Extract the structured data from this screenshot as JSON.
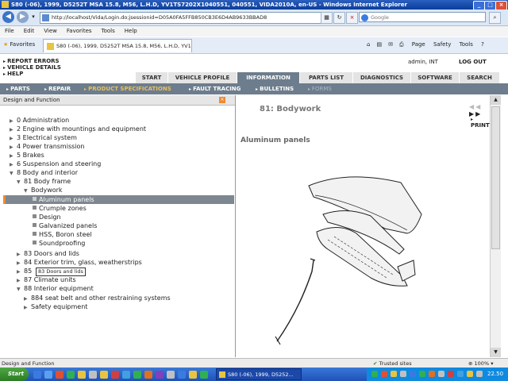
{
  "browser": {
    "title": "S80 (-06), 1999, D5252T MSA 15.8, M56, L.H.D, YV1TS7202X1040551, 040551, VIDA2010A, en-US - Windows Internet Explorer",
    "address": "http://localhost/Vida/Login.do;jsessionid=D05A0FA5FFB850CB3E6D4AB9633BBAD8",
    "search_placeholder": "Google",
    "menu": [
      "File",
      "Edit",
      "View",
      "Favorites",
      "Tools",
      "Help"
    ],
    "favorites_label": "Favorites",
    "tab_title": "S80 (-06), 1999, D5252T MSA 15.8, M56, L.H.D, YV1...",
    "toolbar_items": [
      "Page",
      "Safety",
      "Tools"
    ]
  },
  "app": {
    "top_links": [
      "REPORT ERRORS",
      "VEHICLE DETAILS",
      "HELP"
    ],
    "user": "admin, INT",
    "logout": "LOG OUT",
    "main_tabs": [
      "START",
      "VEHICLE PROFILE",
      "INFORMATION",
      "PARTS LIST",
      "DIAGNOSTICS",
      "SOFTWARE",
      "SEARCH"
    ],
    "active_tab": "INFORMATION",
    "sub_nav": [
      "PARTS",
      "REPAIR",
      "PRODUCT SPECIFICATIONS",
      "FAULT TRACING",
      "BULLETINS",
      "FORMS"
    ],
    "active_sub_nav": "PRODUCT SPECIFICATIONS"
  },
  "left_panel": {
    "title": "Design and Function",
    "tree": [
      "0 Administration",
      "2 Engine with mountings and equipment",
      "3 Electrical system",
      "4 Power transmission",
      "5 Brakes",
      "6 Suspension and steering",
      "8 Body and interior",
      "81 Body frame",
      "Bodywork",
      "Aluminum panels",
      "Crumple zones",
      "Design",
      "Galvanized panels",
      "HSS, Boron steel",
      "Soundproofing",
      "83 Doors and lids",
      "84 Exterior trim, glass, weatherstrips",
      "85",
      "87 Climate units",
      "88 Interior equipment",
      "884 seat belt and other restraining systems",
      "Safety equipment"
    ],
    "selected": "Aluminum panels",
    "tooltip": "83 Doors and lids"
  },
  "document": {
    "title": "81: Bodywork",
    "print": "PRINT",
    "subtitle": "Aluminum panels"
  },
  "status_bar": {
    "text": "Design and Function",
    "trusted": "Trusted sites",
    "zoom": "100%"
  },
  "taskbar": {
    "start": "Start",
    "window": "S80 (-06), 1999, D5252...",
    "time": "22.50"
  }
}
